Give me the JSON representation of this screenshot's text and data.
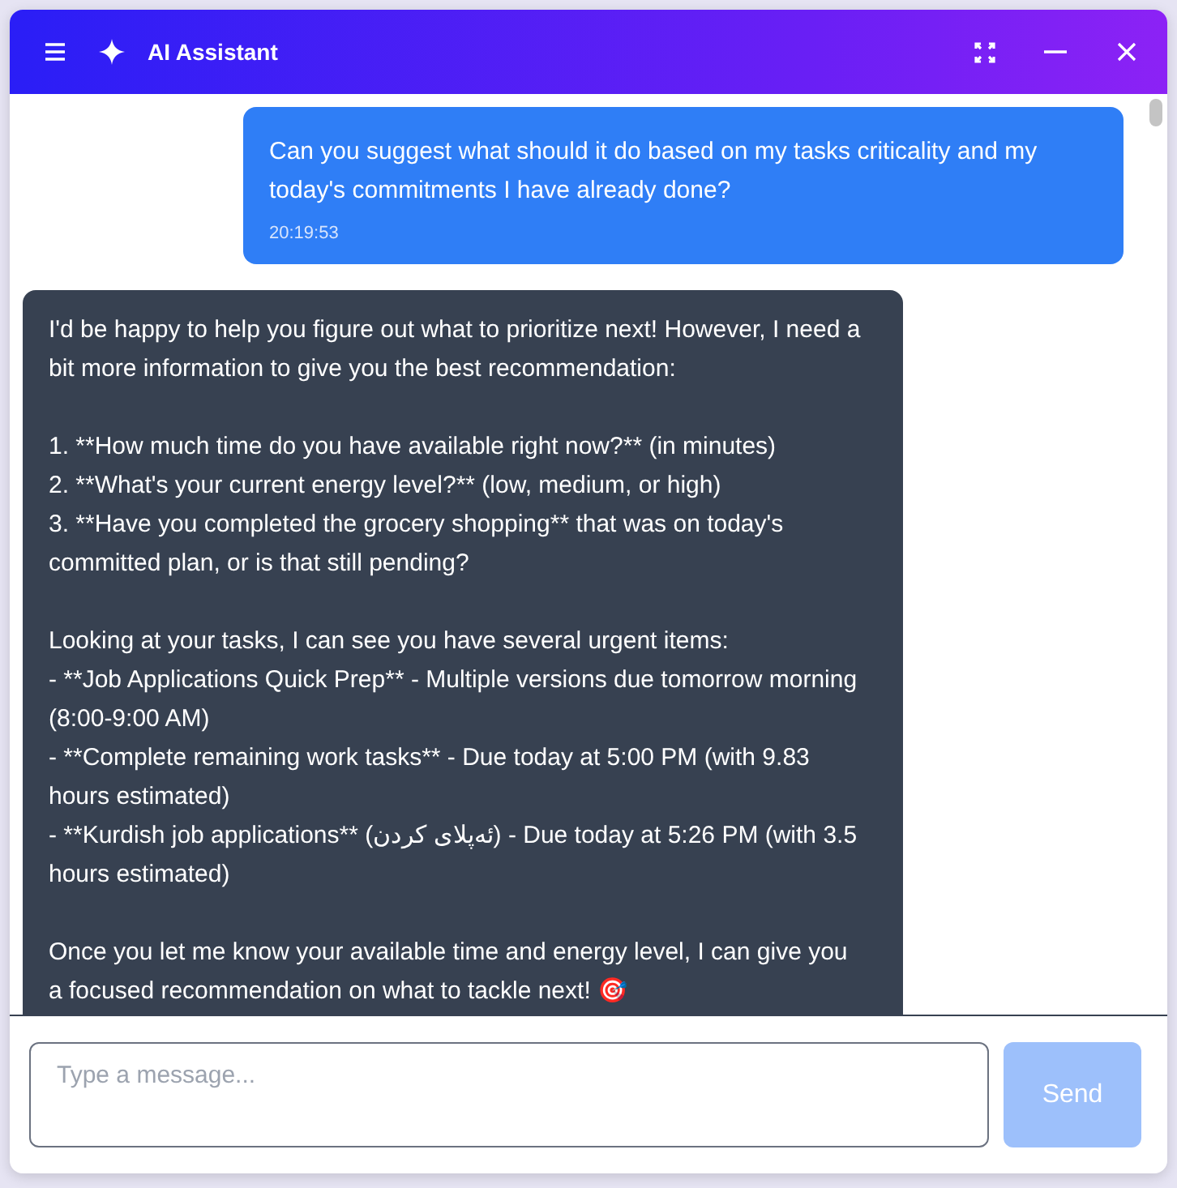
{
  "window": {
    "title": "AI Assistant"
  },
  "messages": [
    {
      "kind": "user",
      "text": "Can you suggest what should it do based on my tasks criticality and my today's commitments I have already done?",
      "time": "20:19:53"
    },
    {
      "kind": "assistant",
      "text": "I'd be happy to help you figure out what to prioritize next! However, I need a bit more information to give you the best recommendation:\n\n1. **How much time do you have available right now?** (in minutes)\n2. **What's your current energy level?** (low, medium, or high)\n3. **Have you completed the grocery shopping** that was on today's committed plan, or is that still pending?\n\nLooking at your tasks, I can see you have several urgent items:\n- **Job Applications Quick Prep** - Multiple versions due tomorrow morning (8:00-9:00 AM)\n- **Complete remaining work tasks** - Due today at 5:00 PM (with 9.83 hours estimated)\n- **Kurdish job applications** (ئەپلای کردن) - Due today at 5:26 PM (with 3.5 hours estimated)\n\nOnce you let me know your available time and energy level, I can give you a focused recommendation on what to tackle next! 🎯"
    }
  ],
  "composer": {
    "placeholder": "Type a message...",
    "send": {
      "label": "Send",
      "disabled": true
    }
  }
}
